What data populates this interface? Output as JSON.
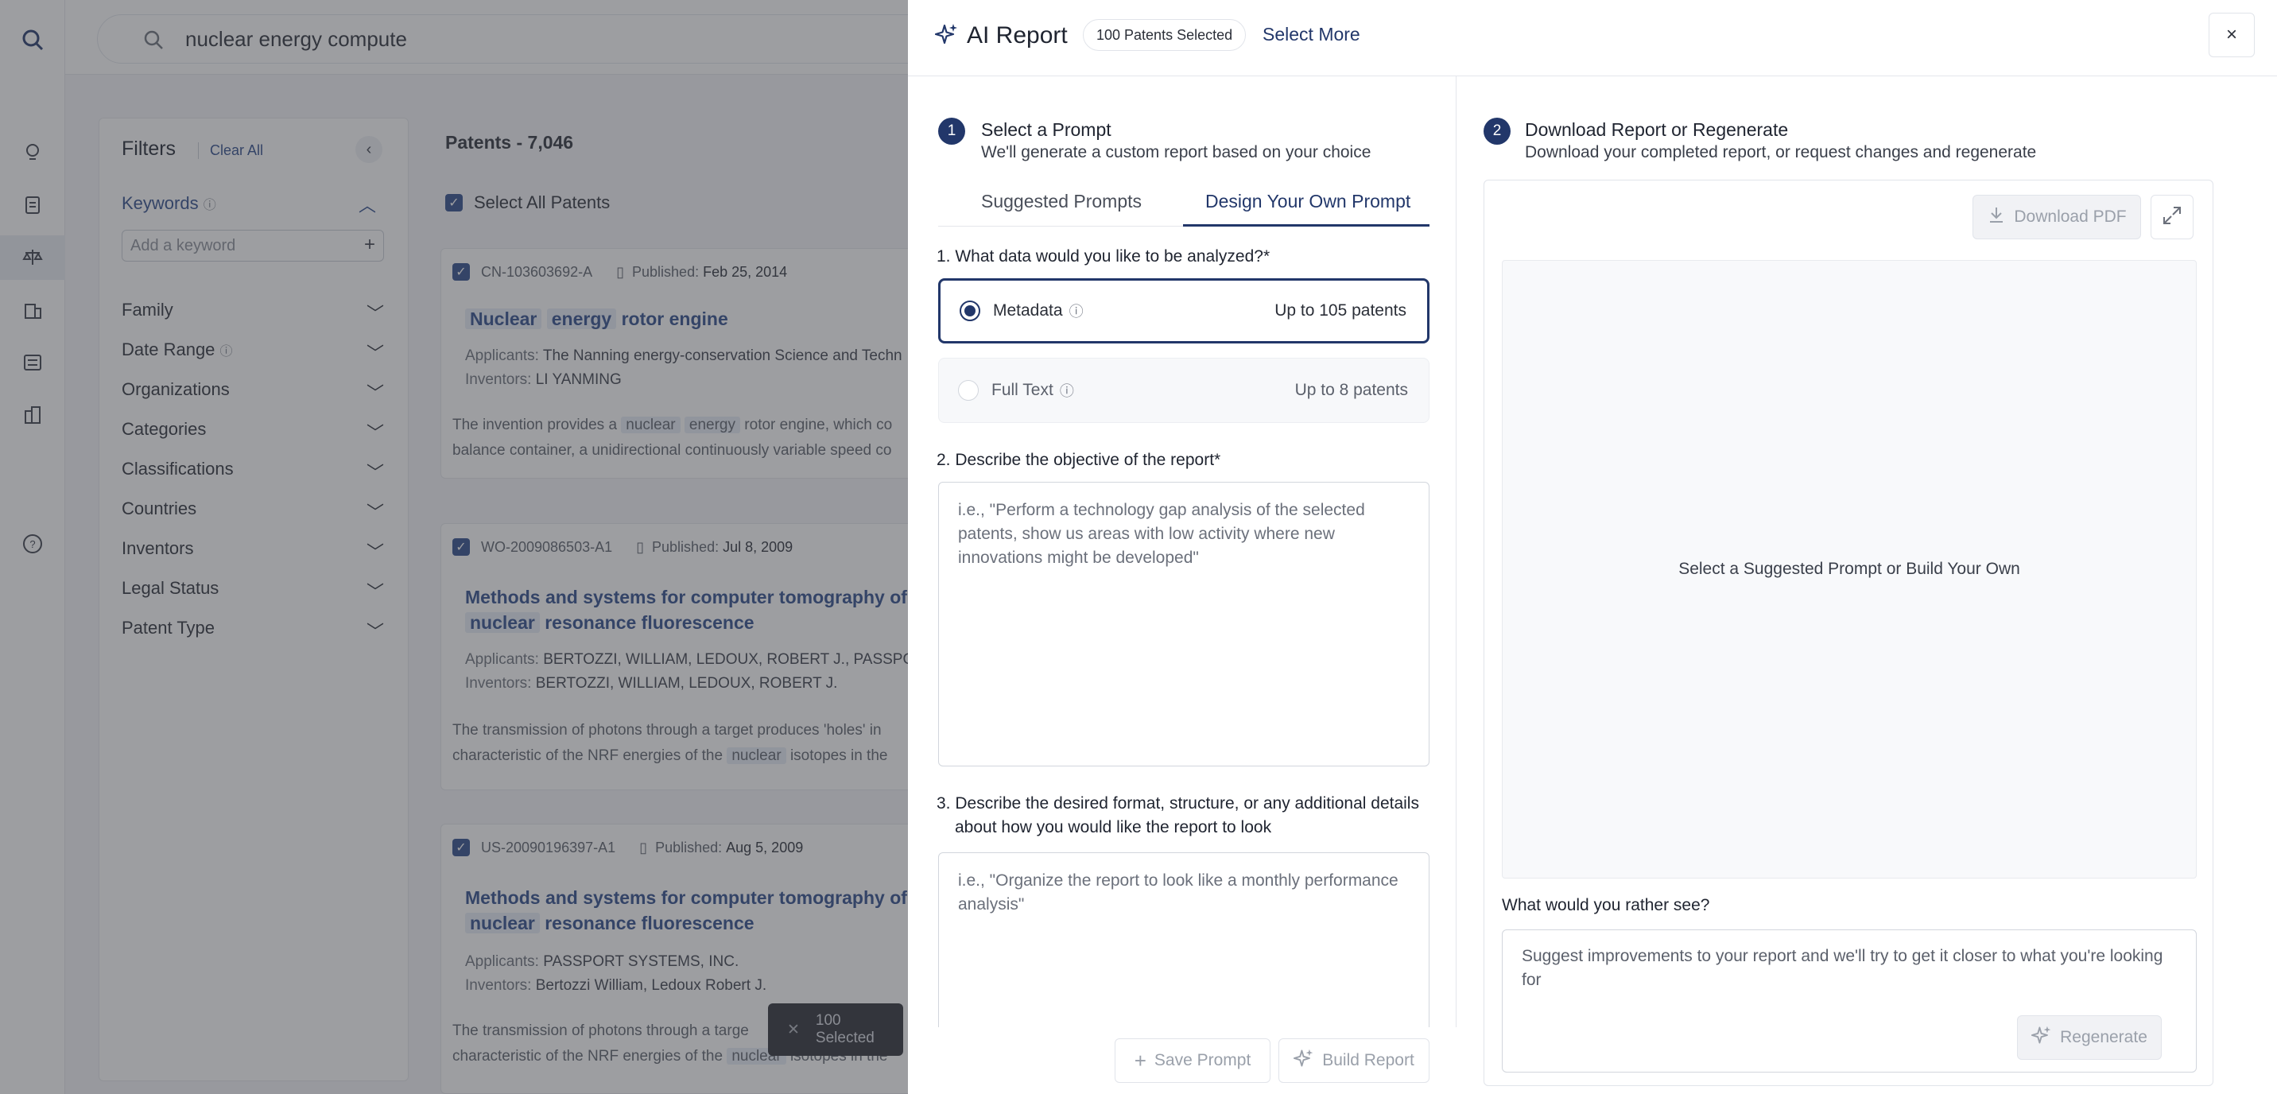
{
  "app": {
    "search_query": "nuclear energy compute",
    "filters": {
      "title": "Filters",
      "clear_all": "Clear All",
      "keywords_label": "Keywords",
      "keyword_placeholder": "Add a keyword",
      "groups": [
        "Family",
        "Date Range",
        "Organizations",
        "Categories",
        "Classifications",
        "Countries",
        "Inventors",
        "Legal Status",
        "Patent Type"
      ]
    },
    "results": {
      "count_label": "Patents - 7,046",
      "select_all": "Select All Patents",
      "cards": [
        {
          "id": "CN-103603692-A",
          "published_label": "Published:",
          "published": "Feb 25, 2014",
          "title_parts": [
            "Nuclear",
            "energy",
            "rotor engine"
          ],
          "applicants_label": "Applicants:",
          "applicants": "The Nanning energy-conservation Science and Techn",
          "inventors_label": "Inventors:",
          "inventors": "LI YANMING",
          "abstract_line1_a": "The invention provides a",
          "abstract_hl1": "nuclear",
          "abstract_hl2": "energy",
          "abstract_line1_b": "rotor engine, which co",
          "abstract_line2": "balance container, a unidirectional continuously variable speed co"
        },
        {
          "id": "WO-2009086503-A1",
          "published_label": "Published:",
          "published": "Jul 8, 2009",
          "title_line1": "Methods and systems for computer tomography of",
          "title_hl1": "nuc",
          "title_hl2": "nuclear",
          "title_line2": "resonance fluorescence",
          "applicants_label": "Applicants:",
          "applicants": "BERTOZZI, WILLIAM, LEDOUX, ROBERT J., PASSPOR",
          "inventors_label": "Inventors:",
          "inventors": "BERTOZZI, WILLIAM, LEDOUX, ROBERT J.",
          "abstract_line1": "The transmission of photons through a target produces 'holes' in",
          "abstract_line2_a": "characteristic of the NRF energies of the",
          "abstract_hl": "nuclear",
          "abstract_line2_b": "isotopes in the"
        },
        {
          "id": "US-20090196397-A1",
          "published_label": "Published:",
          "published": "Aug 5, 2009",
          "title_line1": "Methods and systems for computer tomography of",
          "title_hl1": "nuc",
          "title_hl2": "nuclear",
          "title_line2": "resonance fluorescence",
          "applicants_label": "Applicants:",
          "applicants": "PASSPORT SYSTEMS, INC.",
          "inventors_label": "Inventors:",
          "inventors": "Bertozzi William, Ledoux Robert J.",
          "abstract_line1": "The transmission of photons through a targe",
          "abstract_line2_a": "characteristic of the NRF energies of the",
          "abstract_hl": "nuclear",
          "abstract_line2_b": "isotopes in the"
        }
      ],
      "toast": "100 Selected"
    }
  },
  "panel": {
    "title": "AI Report",
    "badge": "100 Patents Selected",
    "select_more": "Select More",
    "close": "×",
    "step1": {
      "num": "1",
      "title": "Select a Prompt",
      "subtitle": "We'll generate a custom report based on your choice",
      "tabs": [
        "Suggested Prompts",
        "Design Your Own Prompt"
      ],
      "active_tab": 1,
      "q1": "1. What data would you like to be analyzed?",
      "required_mark": "*",
      "options": [
        {
          "label": "Metadata",
          "limit": "Up to 105 patents",
          "selected": true
        },
        {
          "label": "Full Text",
          "limit": "Up to 8 patents",
          "selected": false
        }
      ],
      "q2": "2. Describe the objective of the report",
      "q2_placeholder": "i.e., \"Perform a technology gap analysis of the selected patents, show us areas with low activity where new innovations might be developed\"",
      "q3_line1": "3. Describe the desired format, structure, or any additional details",
      "q3_line2": "about how you would like the report to look",
      "q3_placeholder": "i.e., \"Organize the report to look like a monthly performance analysis\"",
      "save_prompt": "Save Prompt",
      "build_report": "Build Report"
    },
    "step2": {
      "num": "2",
      "title": "Download Report or Regenerate",
      "subtitle": "Download your completed report, or request changes and regenerate",
      "download_pdf": "Download PDF",
      "preview_text": "Select a Suggested Prompt or Build Your Own",
      "rather_label": "What would you rather see?",
      "rather_placeholder": "Suggest improvements to your report and we'll try to get it closer to what you're looking for",
      "regenerate": "Regenerate"
    }
  },
  "colors": {
    "accent": "#22376a",
    "link": "#2d4a8a",
    "overlay": "#3c3e44",
    "highlight": "#e6ecf7"
  }
}
